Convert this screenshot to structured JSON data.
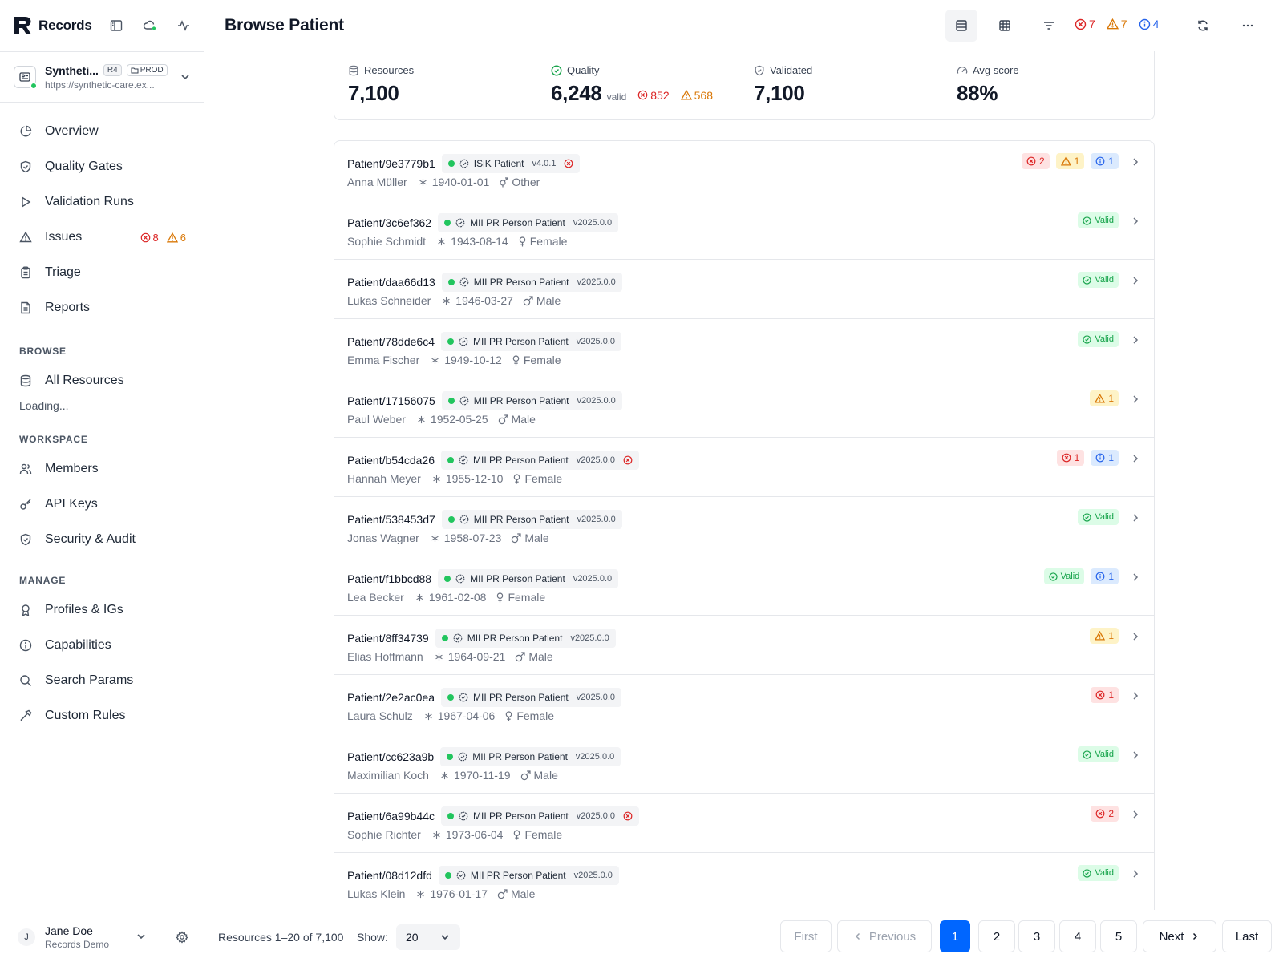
{
  "brand": {
    "name": "Records"
  },
  "server": {
    "name": "Syntheti...",
    "fhir_version": "R4",
    "env": "PROD",
    "url": "https://synthetic-care.ex..."
  },
  "nav": {
    "main": [
      {
        "label": "Overview",
        "icon": "pie-chart-icon"
      },
      {
        "label": "Quality Gates",
        "icon": "shield-icon"
      },
      {
        "label": "Validation Runs",
        "icon": "play-icon"
      },
      {
        "label": "Issues",
        "icon": "warning-icon",
        "errors": "8",
        "warnings": "6"
      },
      {
        "label": "Triage",
        "icon": "clipboard-icon"
      },
      {
        "label": "Reports",
        "icon": "document-icon"
      }
    ],
    "browse_title": "BROWSE",
    "browse": [
      {
        "label": "All Resources",
        "icon": "database-icon"
      }
    ],
    "browse_loading": "Loading...",
    "workspace_title": "WORKSPACE",
    "workspace": [
      {
        "label": "Members",
        "icon": "users-icon"
      },
      {
        "label": "API Keys",
        "icon": "key-icon"
      },
      {
        "label": "Security & Audit",
        "icon": "shield-icon"
      }
    ],
    "manage_title": "MANAGE",
    "manage": [
      {
        "label": "Profiles & IGs",
        "icon": "award-icon"
      },
      {
        "label": "Capabilities",
        "icon": "info-icon"
      },
      {
        "label": "Search Params",
        "icon": "search-icon"
      },
      {
        "label": "Custom Rules",
        "icon": "hammer-icon"
      }
    ]
  },
  "user": {
    "initial": "J",
    "name": "Jane Doe",
    "org": "Records Demo"
  },
  "header": {
    "title": "Browse Patient",
    "errors": "7",
    "warnings": "7",
    "infos": "4"
  },
  "stats": {
    "resources_label": "Resources",
    "resources": "7,100",
    "quality_label": "Quality",
    "quality": "6,248",
    "quality_suffix": "valid",
    "quality_errors": "852",
    "quality_warnings": "568",
    "validated_label": "Validated",
    "validated": "7,100",
    "avg_label": "Avg score",
    "avg": "88%"
  },
  "rows": [
    {
      "id": "Patient/9e3779b1",
      "profile": "ISiK Patient",
      "version": "v4.0.1",
      "profile_error": true,
      "name": "Anna Müller",
      "birth": "1940-01-01",
      "gender": "Other",
      "gender_icon": "transgender-icon",
      "errors": "2",
      "warnings": "1",
      "infos": "1",
      "valid": ""
    },
    {
      "id": "Patient/3c6ef362",
      "profile": "MII PR Person Patient",
      "version": "v2025.0.0",
      "profile_error": false,
      "name": "Sophie Schmidt",
      "birth": "1943-08-14",
      "gender": "Female",
      "gender_icon": "female-icon",
      "errors": "",
      "warnings": "",
      "infos": "",
      "valid": "Valid"
    },
    {
      "id": "Patient/daa66d13",
      "profile": "MII PR Person Patient",
      "version": "v2025.0.0",
      "profile_error": false,
      "name": "Lukas Schneider",
      "birth": "1946-03-27",
      "gender": "Male",
      "gender_icon": "male-icon",
      "errors": "",
      "warnings": "",
      "infos": "",
      "valid": "Valid"
    },
    {
      "id": "Patient/78dde6c4",
      "profile": "MII PR Person Patient",
      "version": "v2025.0.0",
      "profile_error": false,
      "name": "Emma Fischer",
      "birth": "1949-10-12",
      "gender": "Female",
      "gender_icon": "female-icon",
      "errors": "",
      "warnings": "",
      "infos": "",
      "valid": "Valid"
    },
    {
      "id": "Patient/17156075",
      "profile": "MII PR Person Patient",
      "version": "v2025.0.0",
      "profile_error": false,
      "name": "Paul Weber",
      "birth": "1952-05-25",
      "gender": "Male",
      "gender_icon": "male-icon",
      "errors": "",
      "warnings": "1",
      "infos": "",
      "valid": ""
    },
    {
      "id": "Patient/b54cda26",
      "profile": "MII PR Person Patient",
      "version": "v2025.0.0",
      "profile_error": true,
      "name": "Hannah Meyer",
      "birth": "1955-12-10",
      "gender": "Female",
      "gender_icon": "female-icon",
      "errors": "1",
      "warnings": "",
      "infos": "1",
      "valid": ""
    },
    {
      "id": "Patient/538453d7",
      "profile": "MII PR Person Patient",
      "version": "v2025.0.0",
      "profile_error": false,
      "name": "Jonas Wagner",
      "birth": "1958-07-23",
      "gender": "Male",
      "gender_icon": "male-icon",
      "errors": "",
      "warnings": "",
      "infos": "",
      "valid": "Valid"
    },
    {
      "id": "Patient/f1bbcd88",
      "profile": "MII PR Person Patient",
      "version": "v2025.0.0",
      "profile_error": false,
      "name": "Lea Becker",
      "birth": "1961-02-08",
      "gender": "Female",
      "gender_icon": "female-icon",
      "errors": "",
      "warnings": "",
      "infos": "1",
      "valid": "Valid"
    },
    {
      "id": "Patient/8ff34739",
      "profile": "MII PR Person Patient",
      "version": "v2025.0.0",
      "profile_error": false,
      "name": "Elias Hoffmann",
      "birth": "1964-09-21",
      "gender": "Male",
      "gender_icon": "male-icon",
      "errors": "",
      "warnings": "1",
      "infos": "",
      "valid": ""
    },
    {
      "id": "Patient/2e2ac0ea",
      "profile": "MII PR Person Patient",
      "version": "v2025.0.0",
      "profile_error": false,
      "name": "Laura Schulz",
      "birth": "1967-04-06",
      "gender": "Female",
      "gender_icon": "female-icon",
      "errors": "1",
      "warnings": "",
      "infos": "",
      "valid": ""
    },
    {
      "id": "Patient/cc623a9b",
      "profile": "MII PR Person Patient",
      "version": "v2025.0.0",
      "profile_error": false,
      "name": "Maximilian Koch",
      "birth": "1970-11-19",
      "gender": "Male",
      "gender_icon": "male-icon",
      "errors": "",
      "warnings": "",
      "infos": "",
      "valid": "Valid"
    },
    {
      "id": "Patient/6a99b44c",
      "profile": "MII PR Person Patient",
      "version": "v2025.0.0",
      "profile_error": true,
      "name": "Sophie Richter",
      "birth": "1973-06-04",
      "gender": "Female",
      "gender_icon": "female-icon",
      "errors": "2",
      "warnings": "",
      "infos": "",
      "valid": ""
    },
    {
      "id": "Patient/08d12dfd",
      "profile": "MII PR Person Patient",
      "version": "v2025.0.0",
      "profile_error": false,
      "name": "Lukas Klein",
      "birth": "1976-01-17",
      "gender": "Male",
      "gender_icon": "male-icon",
      "errors": "",
      "warnings": "",
      "infos": "",
      "valid": "Valid"
    }
  ],
  "footer": {
    "range": "Resources 1–20 of 7,100",
    "show_label": "Show:",
    "page_size": "20",
    "first": "First",
    "previous": "Previous",
    "next": "Next",
    "last": "Last",
    "pages": [
      "1",
      "2",
      "3",
      "4",
      "5"
    ],
    "current_page": "1"
  },
  "colors": {
    "accent": "#0066ff",
    "error": "#dc2626",
    "warning": "#d97706",
    "info": "#2563eb",
    "success": "#16a34a"
  }
}
